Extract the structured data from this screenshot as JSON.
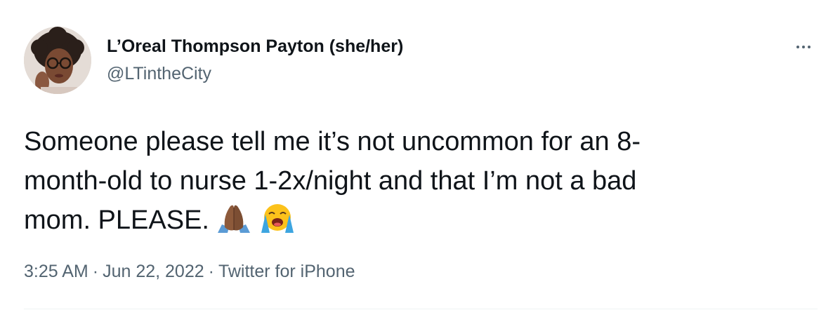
{
  "author": {
    "display_name": "L’Oreal Thompson Payton (she/her)",
    "handle": "@LTintheCity",
    "avatar_icon": "profile-photo"
  },
  "more_icon": "more-horizontal-icon",
  "tweet": {
    "text": "Someone please tell me it’s not uncommon for an 8-\nmonth-old to nurse 1-2x/night and that I’m not a bad\nmom. PLEASE.",
    "emojis": [
      "folded-hands-medium-dark-skin-emoji",
      "loudly-crying-face-emoji"
    ]
  },
  "meta": {
    "time": "3:25 AM",
    "separator": "·",
    "date": "Jun 22, 2022",
    "source": "Twitter for iPhone"
  },
  "colors": {
    "primary_text": "#0f1419",
    "secondary_text": "#536471",
    "divider": "#eff3f4"
  }
}
